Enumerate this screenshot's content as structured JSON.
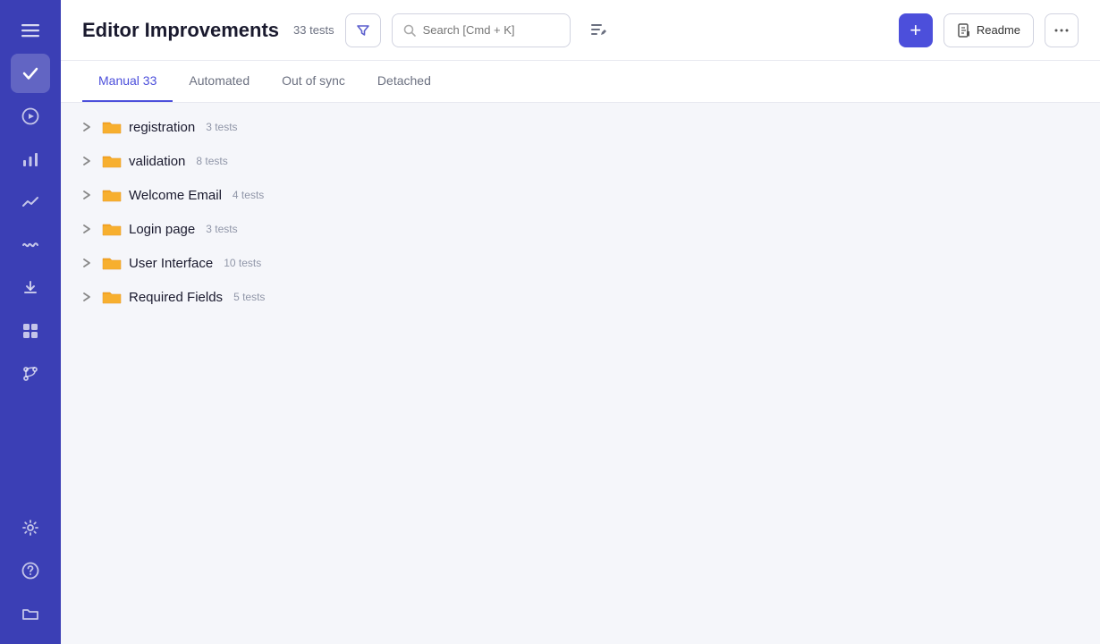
{
  "sidebar": {
    "icons": [
      {
        "name": "menu-icon",
        "symbol": "☰",
        "active": false
      },
      {
        "name": "check-icon",
        "symbol": "✓",
        "active": true
      },
      {
        "name": "play-icon",
        "symbol": "▶",
        "active": false
      },
      {
        "name": "list-icon",
        "symbol": "≡",
        "active": false
      },
      {
        "name": "chart-line-icon",
        "symbol": "⟋",
        "active": false
      },
      {
        "name": "wave-icon",
        "symbol": "∿",
        "active": false
      },
      {
        "name": "import-icon",
        "symbol": "⬇",
        "active": false
      },
      {
        "name": "bar-chart-icon",
        "symbol": "▦",
        "active": false
      },
      {
        "name": "fork-icon",
        "symbol": "⑂",
        "active": false
      },
      {
        "name": "settings-icon",
        "symbol": "⚙",
        "active": false
      },
      {
        "name": "help-icon",
        "symbol": "?",
        "active": false
      },
      {
        "name": "folder-bottom-icon",
        "symbol": "🗂",
        "active": false
      }
    ]
  },
  "header": {
    "title": "Editor Improvements",
    "total_tests": "33 tests",
    "filter_label": "Filter",
    "search_placeholder": "Search [Cmd + K]",
    "add_label": "+",
    "readme_label": "Readme",
    "more_label": "..."
  },
  "tabs": [
    {
      "id": "manual",
      "label": "Manual 33",
      "active": true
    },
    {
      "id": "automated",
      "label": "Automated",
      "active": false
    },
    {
      "id": "out-of-sync",
      "label": "Out of sync",
      "active": false
    },
    {
      "id": "detached",
      "label": "Detached",
      "active": false
    }
  ],
  "folders": [
    {
      "name": "registration",
      "count": "3 tests"
    },
    {
      "name": "validation",
      "count": "8 tests"
    },
    {
      "name": "Welcome Email",
      "count": "4 tests"
    },
    {
      "name": "Login page",
      "count": "3 tests"
    },
    {
      "name": "User Interface",
      "count": "10 tests"
    },
    {
      "name": "Required Fields",
      "count": "5 tests"
    }
  ]
}
